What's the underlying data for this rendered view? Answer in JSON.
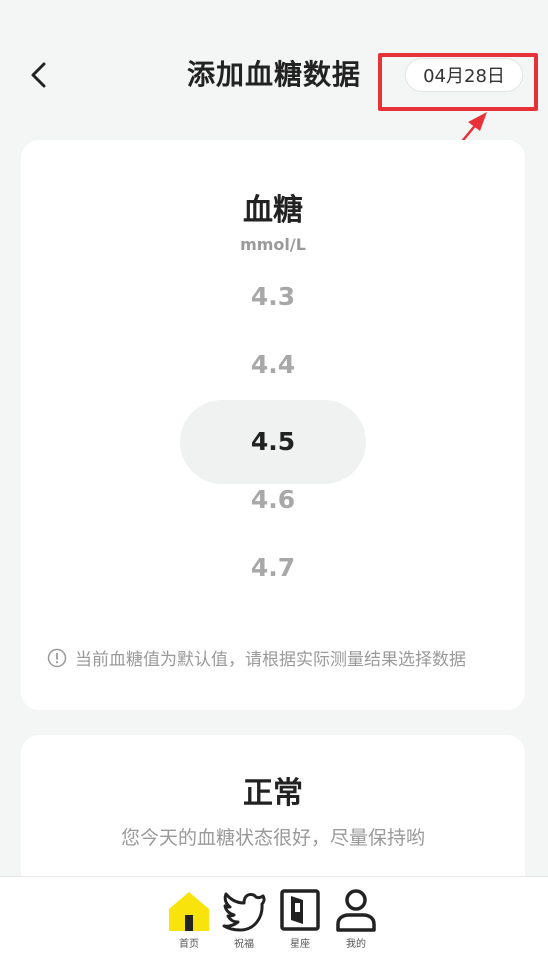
{
  "header": {
    "title": "添加血糖数据",
    "date": "04月28日"
  },
  "metric": {
    "name": "血糖",
    "unit": "mmol/L",
    "options": [
      "4.3",
      "4.4",
      "4.5",
      "4.6",
      "4.7"
    ],
    "selected": "4.5",
    "notice": "当前血糖值为默认值，请根据实际测量结果选择数据"
  },
  "status": {
    "title": "正常",
    "description": "您今天的血糖状态很好，尽量保持哟"
  },
  "nav": {
    "items": [
      {
        "label": "首页",
        "icon": "home-icon",
        "active": true
      },
      {
        "label": "祝福",
        "icon": "bird-icon"
      },
      {
        "label": "星座",
        "icon": "door-icon"
      },
      {
        "label": "我的",
        "icon": "user-icon"
      }
    ]
  },
  "colors": {
    "accent": "#f8e30c",
    "highlight": "#e8323a",
    "background": "#f4f6f5"
  }
}
